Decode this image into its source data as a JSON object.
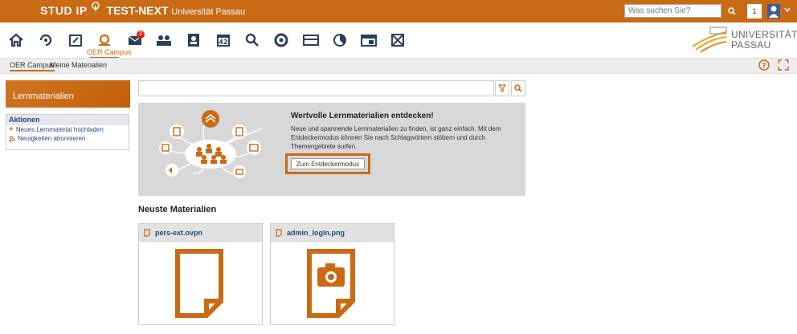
{
  "brand": {
    "logo": "STUD IP",
    "name": "TEST-NEXT",
    "subtitle": "Universität Passau"
  },
  "header": {
    "search_placeholder": "Was suchen Sie?",
    "notification_count": "1",
    "accent_color": "#c96a14",
    "avatar_color": "#3c5d9a"
  },
  "nav": {
    "active_label": "OER Campus",
    "message_badge": "3",
    "icons": [
      "home-icon",
      "activity-icon",
      "courses-icon",
      "oer-campus-icon",
      "messages-icon",
      "community-icon",
      "profile-icon",
      "calendar-icon",
      "search-icon",
      "lifesaver-icon",
      "payment-icon",
      "stats-icon",
      "admin-icon",
      "dashboard-icon"
    ],
    "calendar_day": "42"
  },
  "university": {
    "line1": "UNIVERSITÄT",
    "line2": "PASSAU"
  },
  "tabs": [
    {
      "label": "OER Campus",
      "active": true
    },
    {
      "label": "Meine Materialien",
      "active": false
    }
  ],
  "sidebar": {
    "title": "Lernmaterialien",
    "actions_title": "Aktionen",
    "actions": [
      {
        "label": "Neues Lernmaterial hochladen",
        "icon": "plus-icon"
      },
      {
        "label": "Neuigkeiten abonnieren",
        "icon": "rss-icon"
      }
    ]
  },
  "hero": {
    "title": "Wertvolle Lernmaterialien entdecken!",
    "text": "Neue und spannende Lernmaterialien zu finden, ist ganz einfach. Mit dem Entdeckermodus können Sie nach Schlagwörtern stöbern und durch Themengebiete surfen.",
    "button": "Zum Entdeckermodus"
  },
  "newest": {
    "title": "Neuste Materialien",
    "items": [
      {
        "name": "pers-ext.ovpn",
        "icon": "file-icon"
      },
      {
        "name": "admin_login.png",
        "icon": "image-file-icon"
      }
    ]
  }
}
